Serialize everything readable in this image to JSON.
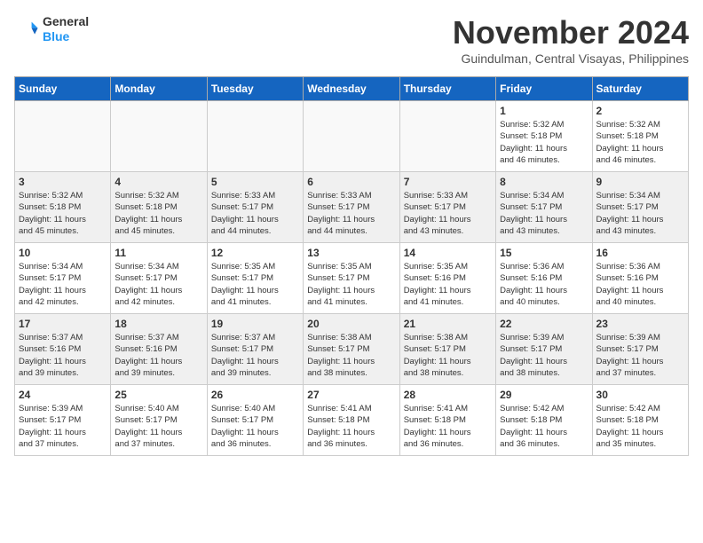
{
  "header": {
    "logo_line1": "General",
    "logo_line2": "Blue",
    "month_year": "November 2024",
    "location": "Guindulman, Central Visayas, Philippines"
  },
  "days_of_week": [
    "Sunday",
    "Monday",
    "Tuesday",
    "Wednesday",
    "Thursday",
    "Friday",
    "Saturday"
  ],
  "weeks": [
    [
      {
        "day": "",
        "info": ""
      },
      {
        "day": "",
        "info": ""
      },
      {
        "day": "",
        "info": ""
      },
      {
        "day": "",
        "info": ""
      },
      {
        "day": "",
        "info": ""
      },
      {
        "day": "1",
        "info": "Sunrise: 5:32 AM\nSunset: 5:18 PM\nDaylight: 11 hours\nand 46 minutes."
      },
      {
        "day": "2",
        "info": "Sunrise: 5:32 AM\nSunset: 5:18 PM\nDaylight: 11 hours\nand 46 minutes."
      }
    ],
    [
      {
        "day": "3",
        "info": "Sunrise: 5:32 AM\nSunset: 5:18 PM\nDaylight: 11 hours\nand 45 minutes."
      },
      {
        "day": "4",
        "info": "Sunrise: 5:32 AM\nSunset: 5:18 PM\nDaylight: 11 hours\nand 45 minutes."
      },
      {
        "day": "5",
        "info": "Sunrise: 5:33 AM\nSunset: 5:17 PM\nDaylight: 11 hours\nand 44 minutes."
      },
      {
        "day": "6",
        "info": "Sunrise: 5:33 AM\nSunset: 5:17 PM\nDaylight: 11 hours\nand 44 minutes."
      },
      {
        "day": "7",
        "info": "Sunrise: 5:33 AM\nSunset: 5:17 PM\nDaylight: 11 hours\nand 43 minutes."
      },
      {
        "day": "8",
        "info": "Sunrise: 5:34 AM\nSunset: 5:17 PM\nDaylight: 11 hours\nand 43 minutes."
      },
      {
        "day": "9",
        "info": "Sunrise: 5:34 AM\nSunset: 5:17 PM\nDaylight: 11 hours\nand 43 minutes."
      }
    ],
    [
      {
        "day": "10",
        "info": "Sunrise: 5:34 AM\nSunset: 5:17 PM\nDaylight: 11 hours\nand 42 minutes."
      },
      {
        "day": "11",
        "info": "Sunrise: 5:34 AM\nSunset: 5:17 PM\nDaylight: 11 hours\nand 42 minutes."
      },
      {
        "day": "12",
        "info": "Sunrise: 5:35 AM\nSunset: 5:17 PM\nDaylight: 11 hours\nand 41 minutes."
      },
      {
        "day": "13",
        "info": "Sunrise: 5:35 AM\nSunset: 5:17 PM\nDaylight: 11 hours\nand 41 minutes."
      },
      {
        "day": "14",
        "info": "Sunrise: 5:35 AM\nSunset: 5:16 PM\nDaylight: 11 hours\nand 41 minutes."
      },
      {
        "day": "15",
        "info": "Sunrise: 5:36 AM\nSunset: 5:16 PM\nDaylight: 11 hours\nand 40 minutes."
      },
      {
        "day": "16",
        "info": "Sunrise: 5:36 AM\nSunset: 5:16 PM\nDaylight: 11 hours\nand 40 minutes."
      }
    ],
    [
      {
        "day": "17",
        "info": "Sunrise: 5:37 AM\nSunset: 5:16 PM\nDaylight: 11 hours\nand 39 minutes."
      },
      {
        "day": "18",
        "info": "Sunrise: 5:37 AM\nSunset: 5:16 PM\nDaylight: 11 hours\nand 39 minutes."
      },
      {
        "day": "19",
        "info": "Sunrise: 5:37 AM\nSunset: 5:17 PM\nDaylight: 11 hours\nand 39 minutes."
      },
      {
        "day": "20",
        "info": "Sunrise: 5:38 AM\nSunset: 5:17 PM\nDaylight: 11 hours\nand 38 minutes."
      },
      {
        "day": "21",
        "info": "Sunrise: 5:38 AM\nSunset: 5:17 PM\nDaylight: 11 hours\nand 38 minutes."
      },
      {
        "day": "22",
        "info": "Sunrise: 5:39 AM\nSunset: 5:17 PM\nDaylight: 11 hours\nand 38 minutes."
      },
      {
        "day": "23",
        "info": "Sunrise: 5:39 AM\nSunset: 5:17 PM\nDaylight: 11 hours\nand 37 minutes."
      }
    ],
    [
      {
        "day": "24",
        "info": "Sunrise: 5:39 AM\nSunset: 5:17 PM\nDaylight: 11 hours\nand 37 minutes."
      },
      {
        "day": "25",
        "info": "Sunrise: 5:40 AM\nSunset: 5:17 PM\nDaylight: 11 hours\nand 37 minutes."
      },
      {
        "day": "26",
        "info": "Sunrise: 5:40 AM\nSunset: 5:17 PM\nDaylight: 11 hours\nand 36 minutes."
      },
      {
        "day": "27",
        "info": "Sunrise: 5:41 AM\nSunset: 5:18 PM\nDaylight: 11 hours\nand 36 minutes."
      },
      {
        "day": "28",
        "info": "Sunrise: 5:41 AM\nSunset: 5:18 PM\nDaylight: 11 hours\nand 36 minutes."
      },
      {
        "day": "29",
        "info": "Sunrise: 5:42 AM\nSunset: 5:18 PM\nDaylight: 11 hours\nand 36 minutes."
      },
      {
        "day": "30",
        "info": "Sunrise: 5:42 AM\nSunset: 5:18 PM\nDaylight: 11 hours\nand 35 minutes."
      }
    ]
  ]
}
